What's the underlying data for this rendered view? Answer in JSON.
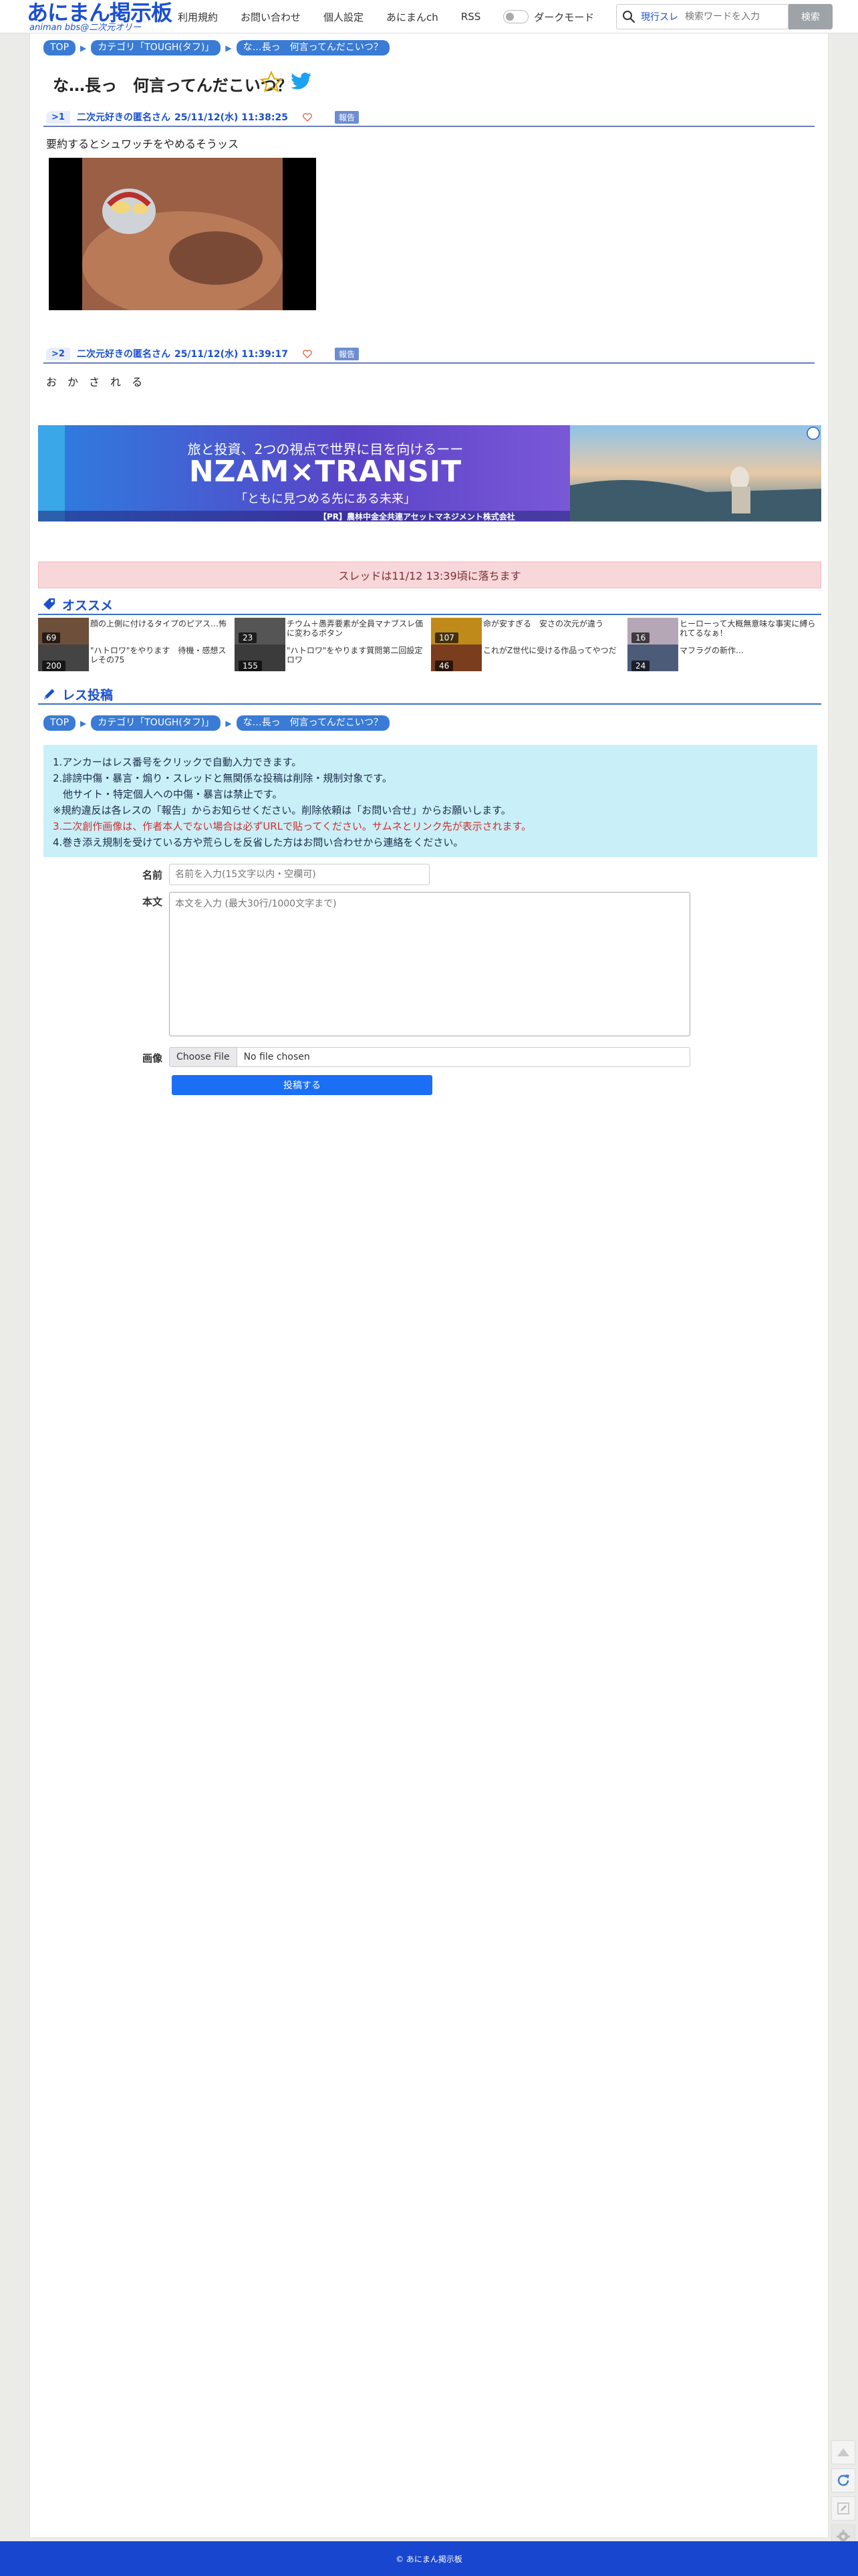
{
  "header": {
    "logo_title": "あにまん掲示板",
    "logo_sub": "animan bbs@二次元オリー",
    "nav": [
      "利用規約",
      "お問い合わせ",
      "個人設定",
      "あにまんch",
      "RSS"
    ],
    "dark_mode_label": "ダークモード",
    "search_scope": "現行スレ",
    "search_placeholder": "検索ワードを入力",
    "search_button": "検索"
  },
  "breadcrumb": [
    "TOP",
    "カテゴリ「TOUGH(タフ)」",
    "な…長っ　何言ってんだこいつ？"
  ],
  "thread_title": "な…長っ　何言ってんだこいつ？",
  "posts": [
    {
      "no": ">1",
      "name": "二次元好きの匿名さん",
      "date": "25/11/12(水) 11:38:25",
      "report": "報告",
      "body": "要約するとシュワッチをやめるそうッス"
    },
    {
      "no": ">2",
      "name": "二次元好きの匿名さん",
      "date": "25/11/12(水) 11:39:17",
      "report": "報告",
      "body": "お　か　さ　れ　る"
    }
  ],
  "ad": {
    "headline": "旅と投資、2つの視点で世界に目を向けるーー",
    "brand": "NZAM×TRANSIT",
    "tagline": "「ともに見つめる先にある未来」",
    "sponsor": "【PR】農林中金全共連アセットマネジメント株式会社"
  },
  "closed_notice": "スレッドは11/12 13:39頃に落ちます",
  "recommend": {
    "title": "オススメ",
    "items": [
      {
        "title": "顔の上側に付けるタイプのピアス…怖",
        "count": "69",
        "color": "#6d4f3a"
      },
      {
        "title": "チウム＋愚弄要素が全員マナブスレ価に変わるボタン",
        "count": "23",
        "color": "#555555"
      },
      {
        "title": "命が安すぎる　安さの次元が違う",
        "count": "107",
        "color": "#c08a1a"
      },
      {
        "title": "ヒーローって大概無意味な事実に縛られてるなぁ！",
        "count": "16",
        "color": "#b6a7b7"
      },
      {
        "title": "\"ハトロワ\"をやります　待機・感想スレその75",
        "count": "200",
        "color": "#444444"
      },
      {
        "title": "\"ハトロワ\"をやります質問第二回設定ロワ",
        "count": "155",
        "color": "#3b3b3b"
      },
      {
        "title": "これがZ世代に受ける作品ってやつだ",
        "count": "46",
        "color": "#7a3d1e"
      },
      {
        "title": "マフラグの新作…",
        "count": "24",
        "color": "#4c5b77"
      }
    ]
  },
  "post_form": {
    "title": "レス投稿",
    "rules": [
      "1.アンカーはレス番号をクリックで自動入力できます。",
      "2.誹謗中傷・暴言・煽り・スレッドと無関係な投稿は削除・規制対象です。",
      "　他サイト・特定個人への中傷・暴言は禁止です。",
      "※規約違反は各レスの「報告」からお知らせください。削除依頼は「お問い合せ」からお願いします。",
      "3.二次創作画像は、作者本人でない場合は必ずURLで貼ってください。サムネとリンク先が表示されます。",
      "4.巻き添え規制を受けている方や荒らしを反省した方はお問い合わせから連絡をください。"
    ],
    "name_label": "名前",
    "name_placeholder": "名前を入力(15文字以内・空欄可)",
    "body_label": "本文",
    "body_placeholder": "本文を入力 (最大30行/1000文字まで)",
    "image_label": "画像",
    "file_button": "Choose File",
    "file_status": "No file chosen",
    "submit": "投稿する"
  },
  "footer": "© あにまん掲示板",
  "colors": {
    "accent": "#1a4fd0",
    "footer": "#1846cf",
    "notice_bg": "#f8d7da",
    "rules_bg": "#c9f0f8"
  }
}
